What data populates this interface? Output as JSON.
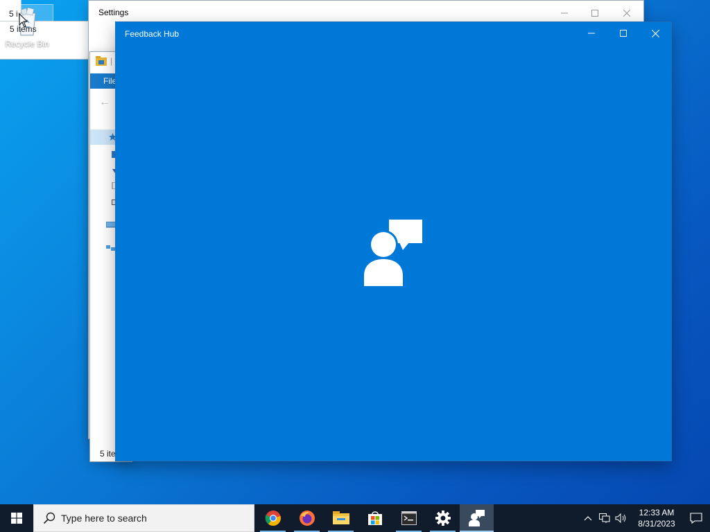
{
  "desktop": {
    "icons": [
      {
        "label": "Recycle Bin",
        "icon": "recycle-bin-icon"
      }
    ]
  },
  "settings_window": {
    "title": "Settings",
    "controls": [
      "minimize-icon",
      "maximize-icon",
      "close-icon"
    ]
  },
  "explorer_window": {
    "ribbon_file_tab": "File",
    "status_truncated": "5 ite",
    "status_truncated_2": "5 i",
    "status": "5 items"
  },
  "feedback_hub": {
    "title": "Feedback Hub",
    "background_color": "#0078d7",
    "splash_icon": "feedback-person-speech-icon"
  },
  "taskbar": {
    "search_placeholder": "Type here to search",
    "apps": [
      {
        "name": "Google Chrome",
        "icon": "chrome-icon",
        "running": true
      },
      {
        "name": "Firefox",
        "icon": "firefox-icon",
        "running": true
      },
      {
        "name": "File Explorer",
        "icon": "file-explorer-icon",
        "running": true
      },
      {
        "name": "Microsoft Store",
        "icon": "store-icon",
        "running": false
      },
      {
        "name": "Terminal",
        "icon": "terminal-icon",
        "running": true
      },
      {
        "name": "Settings",
        "icon": "gear-icon",
        "running": true
      },
      {
        "name": "Feedback Hub",
        "icon": "feedback-hub-icon",
        "running": true,
        "active": true
      }
    ],
    "clock": {
      "time": "12:33 AM",
      "date": "8/31/2023"
    }
  }
}
